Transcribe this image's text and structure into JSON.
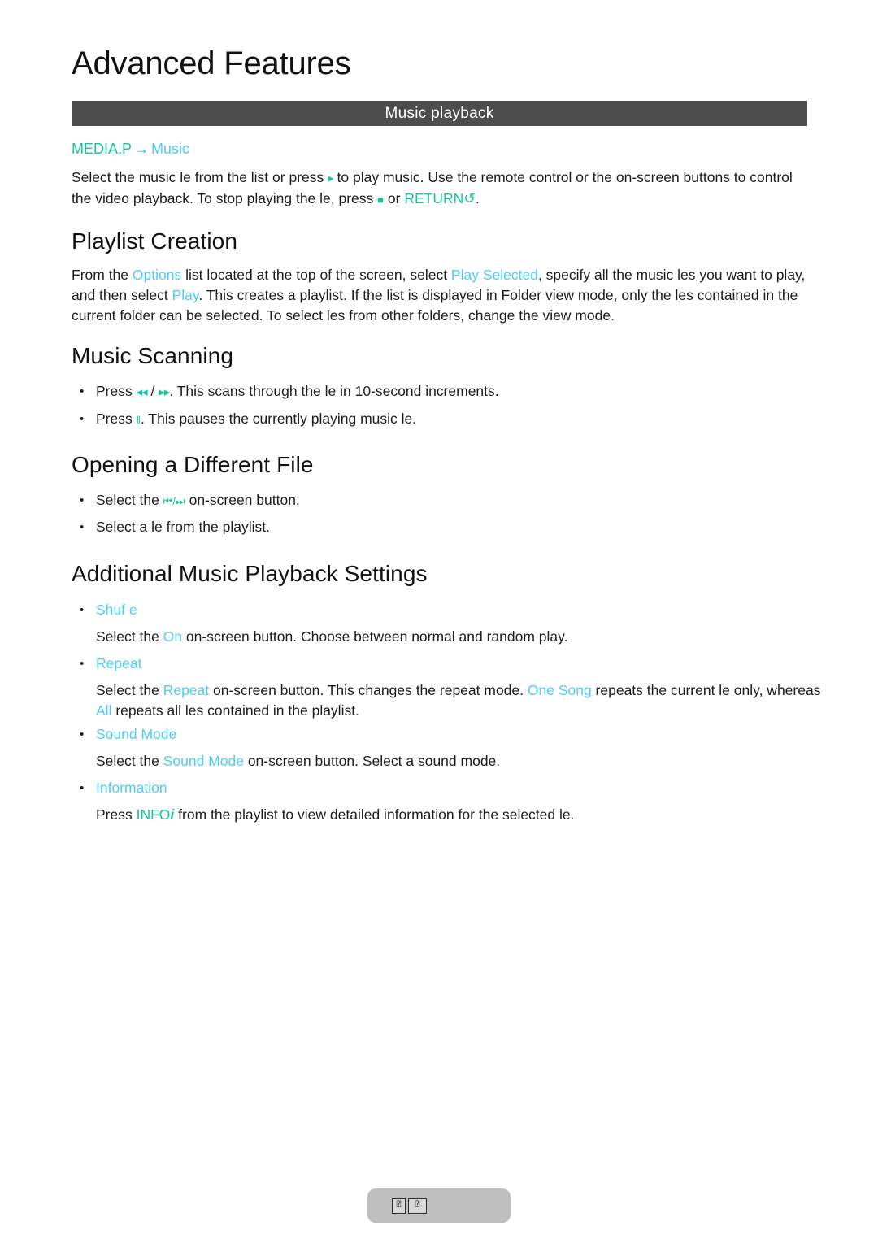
{
  "page": {
    "title": "Advanced Features",
    "section_bar": "Music playback",
    "bar_color": "#4d4d4d",
    "accent_teal": "#16c49b",
    "accent_cyan": "#4ecdf5"
  },
  "breadcrumb": {
    "root": "MEDIA.P",
    "arrow": "→",
    "leaf": "Music"
  },
  "intro": {
    "t1": "Select the music  le from the list or press ",
    "icon_play": "▸",
    "t2": " to play music. Use the remote control or the on-screen buttons to control the video playback. To stop playing the  le, press ",
    "icon_stop": "■",
    "t3": " or ",
    "return_label": "RETURN",
    "return_glyph": "↺",
    "t4": "."
  },
  "sections": [
    {
      "heading": "Playlist Creation",
      "body": {
        "t1": "From the ",
        "k1": "Options",
        "t2": " list located at the top of the screen, select ",
        "k2": "Play Selected",
        "t3": ", specify all the music  les you want to play, and then select ",
        "k3": "Play",
        "t4": ". This creates a playlist. If the list is displayed in Folder view mode, only the  les contained in the current folder can be selected. To select  les from other folders, change the view mode."
      }
    },
    {
      "heading": "Music Scanning",
      "bullets": [
        {
          "t1": "Press ",
          "icon_a": "◂◂",
          "sep": " / ",
          "icon_b": "▸▸",
          "t2": ". This scans through the  le in 10-second increments."
        },
        {
          "t1": "Press ",
          "icon_a": "‖",
          "t2": ". This pauses the currently playing music  le."
        }
      ]
    },
    {
      "heading": "Opening a Different File",
      "bullets": [
        {
          "t1": "Select the ",
          "icon_a": "⏮",
          "sep": "/",
          "icon_b": "⏭",
          "t2": " on-screen button."
        },
        {
          "t1": "Select a  le from the playlist."
        }
      ]
    }
  ],
  "settings": {
    "heading": "Additional Music Playback Settings",
    "items": [
      {
        "label": "Shuf e",
        "body": {
          "t1": "Select the ",
          "k1": "On",
          "t2": " on-screen button. Choose between normal and random play."
        }
      },
      {
        "label": "Repeat",
        "body": {
          "t1": "Select the ",
          "k1": "Repeat",
          "t2": " on-screen button. This changes the repeat mode. ",
          "k2": "One Song",
          "t3": " repeats the current  le only, whereas ",
          "k3": "All",
          "t4": " repeats all  les contained in the playlist."
        }
      },
      {
        "label": "Sound Mode",
        "body": {
          "t1": "Select the ",
          "k1": "Sound Mode",
          "t2": " on-screen button. Select a sound mode."
        }
      },
      {
        "label": "Information",
        "body": {
          "t1": "Press ",
          "k1": "INFO",
          "k1_glyph": "i",
          "t2": " from the playlist to view detailed information for the selected  le."
        }
      }
    ]
  },
  "footer": {
    "tofu_1": "⍰",
    "tofu_2": "⍰"
  }
}
